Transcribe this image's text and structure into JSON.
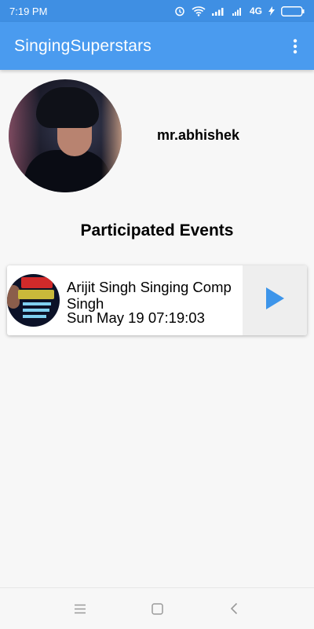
{
  "status_bar": {
    "time": "7:19 PM",
    "network": "4G",
    "icons": [
      "alarm-icon",
      "wifi-icon",
      "signal-icon",
      "signal-icon",
      "battery-icon"
    ]
  },
  "app_bar": {
    "title": "SingingSuperstars",
    "menu_icon": "more-vert-icon"
  },
  "profile": {
    "username": "mr.abhishek"
  },
  "events_section": {
    "title": "Participated Events",
    "events": [
      {
        "title_line1": "Arijit Singh Singing Comp",
        "title_line2": "Singh",
        "date": "Sun May 19 07:19:03",
        "action_icon": "play-arrow-icon"
      }
    ]
  },
  "nav_bar": {
    "icons": [
      "menu-icon",
      "home-square-icon",
      "back-icon"
    ]
  },
  "colors": {
    "status_bar": "#3f8fe3",
    "app_bar": "#4a9bef",
    "accent": "#3d95ea",
    "background": "#f7f7f7"
  }
}
